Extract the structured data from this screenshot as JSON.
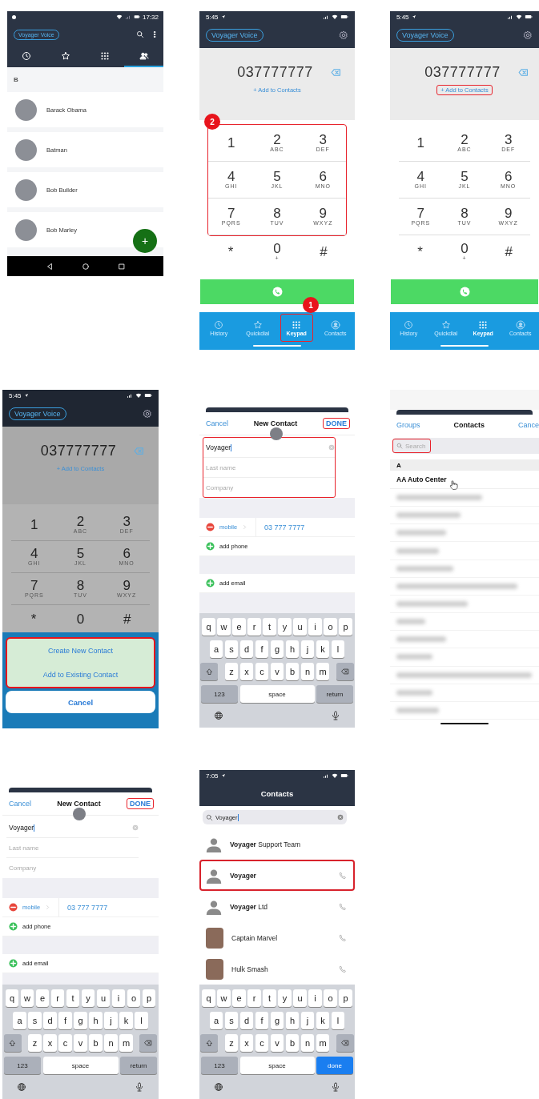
{
  "screens": [
    {
      "kind": "android-contacts",
      "status_time": "17:32",
      "badge": "Voyager Voice",
      "tabs": [
        {
          "kind": "history",
          "selected": false
        },
        {
          "kind": "star",
          "selected": false
        },
        {
          "kind": "keypad",
          "selected": false
        },
        {
          "kind": "people",
          "selected": true
        }
      ],
      "section": "B",
      "contacts": [
        "Barack Obama",
        "Batman",
        "Bob Builder",
        "Bob Marley"
      ],
      "fab": "+"
    },
    {
      "kind": "dialer",
      "dimmed": false,
      "status_time": "5:45",
      "badge": "Voyager Voice",
      "number": "037777777",
      "add_link": "+ Add to Contacts",
      "link_highlighted": false,
      "keys_highlighted": true,
      "keys_callout": "2",
      "keys": [
        {
          "digit": "1"
        },
        {
          "digit": "2",
          "letters": "ABC"
        },
        {
          "digit": "3",
          "letters": "DEF"
        },
        {
          "digit": "4",
          "letters": "GHI"
        },
        {
          "digit": "5",
          "letters": "JKL"
        },
        {
          "digit": "6",
          "letters": "MNO"
        },
        {
          "digit": "7",
          "letters": "PQRS"
        },
        {
          "digit": "8",
          "letters": "TUV"
        },
        {
          "digit": "9",
          "letters": "WXYZ"
        },
        {
          "digit": "*"
        },
        {
          "digit": "0",
          "letters": "+"
        },
        {
          "digit": "#"
        }
      ],
      "tabs": [
        {
          "kind": "history",
          "label": "History",
          "selected": false,
          "highlighted": false
        },
        {
          "kind": "star",
          "label": "Quickdial",
          "selected": false,
          "highlighted": false
        },
        {
          "kind": "keypad",
          "label": "Keypad",
          "selected": true,
          "highlighted": true,
          "callout": "1"
        },
        {
          "kind": "person",
          "label": "Contacts",
          "selected": false,
          "highlighted": false
        }
      ]
    },
    {
      "kind": "dialer",
      "dimmed": false,
      "status_time": "5:45",
      "badge": "Voyager Voice",
      "number": "037777777",
      "add_link": "+ Add to Contacts",
      "link_highlighted": true,
      "keys_highlighted": false,
      "keys": [
        {
          "digit": "1"
        },
        {
          "digit": "2",
          "letters": "ABC"
        },
        {
          "digit": "3",
          "letters": "DEF"
        },
        {
          "digit": "4",
          "letters": "GHI"
        },
        {
          "digit": "5",
          "letters": "JKL"
        },
        {
          "digit": "6",
          "letters": "MNO"
        },
        {
          "digit": "7",
          "letters": "PQRS"
        },
        {
          "digit": "8",
          "letters": "TUV"
        },
        {
          "digit": "9",
          "letters": "WXYZ"
        },
        {
          "digit": "*"
        },
        {
          "digit": "0",
          "letters": "+"
        },
        {
          "digit": "#"
        }
      ],
      "tabs": [
        {
          "kind": "history",
          "label": "History",
          "selected": false,
          "highlighted": false
        },
        {
          "kind": "star",
          "label": "Quickdial",
          "selected": false,
          "highlighted": false
        },
        {
          "kind": "keypad",
          "label": "Keypad",
          "selected": true,
          "highlighted": false
        },
        {
          "kind": "person",
          "label": "Contacts",
          "selected": false,
          "highlighted": false
        }
      ]
    },
    {
      "kind": "dialer",
      "dimmed": true,
      "status_time": "5:45",
      "badge": "Voyager Voice",
      "number": "037777777",
      "add_link": "+ Add to Contacts",
      "link_highlighted": false,
      "keys_highlighted": false,
      "keys": [
        {
          "digit": "1"
        },
        {
          "digit": "2",
          "letters": "ABC"
        },
        {
          "digit": "3",
          "letters": "DEF"
        },
        {
          "digit": "4",
          "letters": "GHI"
        },
        {
          "digit": "5",
          "letters": "JKL"
        },
        {
          "digit": "6",
          "letters": "MNO"
        },
        {
          "digit": "7",
          "letters": "PQRS"
        },
        {
          "digit": "8",
          "letters": "TUV"
        },
        {
          "digit": "9",
          "letters": "WXYZ"
        },
        {
          "digit": "*"
        },
        {
          "digit": "0"
        },
        {
          "digit": "#"
        }
      ],
      "sheet": {
        "options": [
          "Create New Contact",
          "Add to Existing Contact"
        ],
        "highlighted": true,
        "cancel": "Cancel"
      }
    },
    {
      "kind": "new-contact",
      "cancel": "Cancel",
      "title": "New Contact",
      "done": "DONE",
      "done_highlighted": true,
      "fields_highlighted": true,
      "fields": [
        {
          "value": "Voyager"
        },
        {
          "placeholder": "Last name"
        },
        {
          "placeholder": "Company"
        }
      ],
      "phone_label": "mobile",
      "phone": "03 777 7777",
      "add_phone": "add phone",
      "add_email": "add email",
      "keyboard": {
        "rows": [
          [
            "q",
            "w",
            "e",
            "r",
            "t",
            "y",
            "u",
            "i",
            "o",
            "p"
          ],
          [
            "a",
            "s",
            "d",
            "f",
            "g",
            "h",
            "j",
            "k",
            "l"
          ],
          [
            "z",
            "x",
            "c",
            "v",
            "b",
            "n",
            "m"
          ]
        ],
        "numbers": "123",
        "space": "space",
        "action": "return",
        "action_highlighted": false
      }
    },
    {
      "kind": "contact-picker",
      "left": "Groups",
      "title": "Contacts",
      "right": "Cance",
      "search_placeholder": "Search",
      "search_highlighted": true,
      "section": "A",
      "first": "AA Auto Center"
    },
    {
      "kind": "new-contact",
      "cancel": "Cancel",
      "title": "New Contact",
      "done": "DONE",
      "done_highlighted": true,
      "fields_highlighted": false,
      "fields": [
        {
          "value": "Voyager"
        },
        {
          "placeholder": "Last name"
        },
        {
          "placeholder": "Company"
        }
      ],
      "phone_label": "mobile",
      "phone": "03 777 7777",
      "add_phone": "add phone",
      "add_email": "add email",
      "keyboard": {
        "rows": [
          [
            "q",
            "w",
            "e",
            "r",
            "t",
            "y",
            "u",
            "i",
            "o",
            "p"
          ],
          [
            "a",
            "s",
            "d",
            "f",
            "g",
            "h",
            "j",
            "k",
            "l"
          ],
          [
            "z",
            "x",
            "c",
            "v",
            "b",
            "n",
            "m"
          ]
        ],
        "numbers": "123",
        "space": "space",
        "action": "return",
        "action_highlighted": false
      }
    },
    {
      "kind": "search-results",
      "status_time": "7:05",
      "title": "Contacts",
      "query": "Voyager",
      "results": [
        {
          "name": "**Voyager** Support Team",
          "kind": "silhouette",
          "call": false,
          "highlighted": false
        },
        {
          "name": "**Voyager**",
          "kind": "silhouette",
          "call": true,
          "highlighted": true
        },
        {
          "name": "**Voyager** Ltd",
          "kind": "silhouette",
          "call": true,
          "highlighted": false
        },
        {
          "name": "Captain Marvel",
          "kind": "picture",
          "call": true,
          "highlighted": false
        },
        {
          "name": "Hulk Smash",
          "kind": "picture",
          "call": true,
          "highlighted": false
        }
      ],
      "keyboard": {
        "rows": [
          [
            "q",
            "w",
            "e",
            "r",
            "t",
            "y",
            "u",
            "i",
            "o",
            "p"
          ],
          [
            "a",
            "s",
            "d",
            "f",
            "g",
            "h",
            "j",
            "k",
            "l"
          ],
          [
            "z",
            "x",
            "c",
            "v",
            "b",
            "n",
            "m"
          ]
        ],
        "numbers": "123",
        "space": "space",
        "action": "done",
        "action_highlighted": true
      }
    }
  ]
}
